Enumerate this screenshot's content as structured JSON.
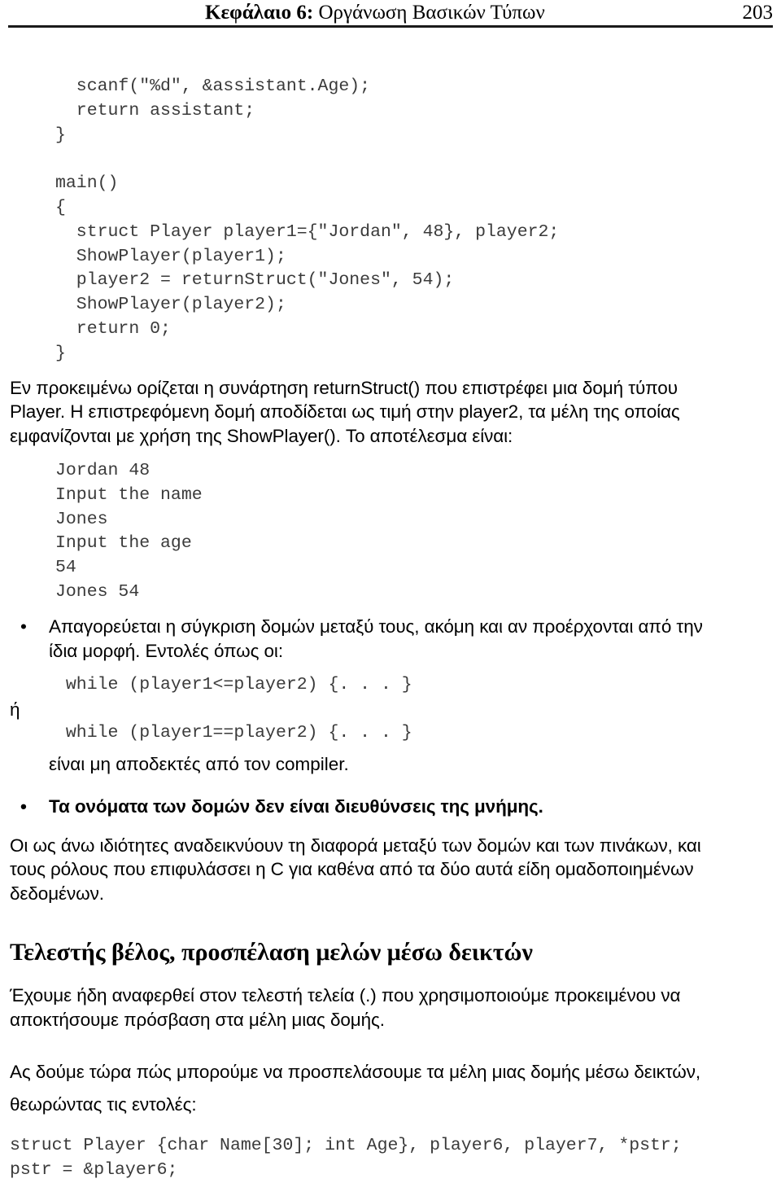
{
  "header": {
    "chapter_label": "Κεφάλαιο 6:",
    "chapter_name": " Οργάνωση Βασικών Τύπων",
    "page_number": "203"
  },
  "code_block_1": {
    "lines": [
      "  scanf(\"%d\", &assistant.Age);",
      "  return assistant;",
      "}",
      "",
      "main()",
      "{",
      "  struct Player player1={\"Jordan\", 48}, player2;",
      "  ShowPlayer(player1);",
      "  player2 = returnStruct(\"Jones\", 54);",
      "  ShowPlayer(player2);",
      "  return 0;",
      "}"
    ]
  },
  "paragraph_1": {
    "line1": "Εν προκειμένω ορίζεται η συνάρτηση returnStruct() που επιστρέφει μια δομή τύπου",
    "line2": "Player. Η επιστρεφόμενη δομή αποδίδεται ως τιμή στην player2, τα μέλη της οποίας",
    "line3": "εμφανίζονται με χρήση της ShowPlayer(). Το αποτέλεσμα είναι:"
  },
  "output_block": {
    "lines": [
      "Jordan 48",
      "Input the name",
      "Jones",
      "Input the age",
      "54",
      "Jones 54"
    ]
  },
  "bullets": [
    {
      "marker": "•",
      "line1": "Απαγορεύεται η σύγκριση δομών μεταξύ τους, ακόμη και αν προέρχονται από την",
      "line2": "ίδια μορφή. Εντολές όπως οι:",
      "bold": false
    },
    {
      "marker": "•",
      "line1": "Τα ονόματα των δομών δεν είναι διευθύνσεις της μνήμης.",
      "line2": "",
      "bold": true
    }
  ],
  "code_while_1": " while (player1<=player2) {. . . }",
  "conjunction": "ή",
  "code_while_2": " while (player1==player2) {. . . }",
  "after_while": "είναι μη αποδεκτές από τον compiler.",
  "paragraph_2": {
    "line1": "Οι ως άνω ιδιότητες αναδεικνύουν τη διαφορά μεταξύ των δομών και των πινάκων, και",
    "line2": "τους ρόλους που επιφυλάσσει η C για καθένα από τα δύο αυτά είδη ομαδοποιημένων",
    "line3": "δεδομένων."
  },
  "section_heading": "Τελεστής βέλος, προσπέλαση μελών μέσω δεικτών",
  "paragraph_3": {
    "line1": "Έχουμε ήδη αναφερθεί στον τελεστή τελεία (.) που χρησιμοποιούμε προκειμένου να",
    "line2": "αποκτήσουμε πρόσβαση στα μέλη μιας δομής."
  },
  "paragraph_4": {
    "line1": "Ας δούμε τώρα πώς μπορούμε να προσπελάσουμε τα μέλη μιας δομής μέσω δεικτών,",
    "line2": "θεωρώντας τις εντολές:"
  },
  "code_block_2": {
    "lines": [
      "struct Player {char Name[30]; int Age}, player6, player7, *pstr;",
      "pstr = &player6;"
    ]
  }
}
